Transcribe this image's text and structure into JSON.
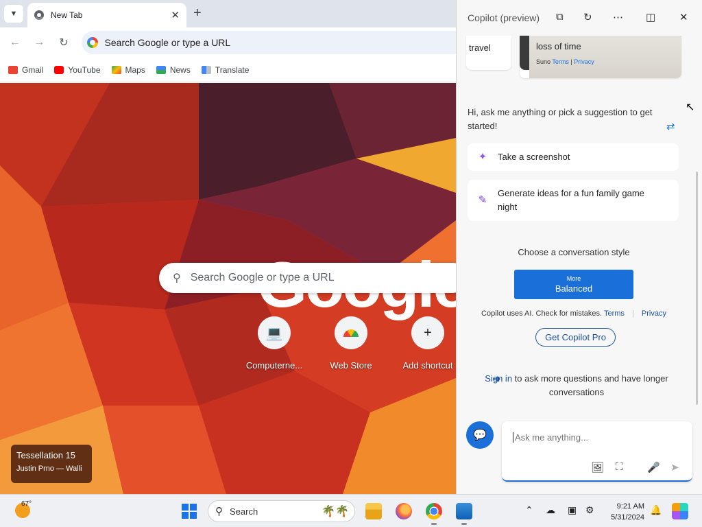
{
  "browser": {
    "tab_title": "New Tab",
    "omnibox_placeholder": "Search Google or type a URL",
    "bookmarks": [
      {
        "label": "Gmail",
        "icon": "gmail-icon",
        "color": "#ea4335"
      },
      {
        "label": "YouTube",
        "icon": "youtube-icon",
        "color": "#ff0000"
      },
      {
        "label": "Maps",
        "icon": "maps-icon",
        "color": "#34a853"
      },
      {
        "label": "News",
        "icon": "news-icon",
        "color": "#4285f4"
      },
      {
        "label": "Translate",
        "icon": "translate-icon",
        "color": "#4285f4"
      }
    ]
  },
  "ntp": {
    "logo": "Google",
    "search_placeholder": "Search Google or type a URL",
    "shortcuts": [
      {
        "label": "Computerne...",
        "icon": "computer-icon"
      },
      {
        "label": "Web Store",
        "icon": "webstore-icon"
      },
      {
        "label": "Add shortcut",
        "icon": "plus-icon"
      }
    ],
    "wallpaper": {
      "title": "Tessellation 15",
      "author": "Justin Prno — Walli"
    }
  },
  "copilot": {
    "title": "Copilot (preview)",
    "card_a_text": "travel",
    "card_b": {
      "title": "loss of time",
      "source": "Suno",
      "terms": "Terms",
      "sep": "|",
      "privacy": "Privacy"
    },
    "greeting": "Hi, ask me anything or pick a suggestion to get started!",
    "suggestions": [
      {
        "label": "Take a screenshot",
        "icon": "sparkle-icon"
      },
      {
        "label": "Generate ideas for a fun family game night",
        "icon": "notepad-icon"
      }
    ],
    "style_label": "Choose a conversation style",
    "style_more": "More",
    "style_selected": "Balanced",
    "disclaimer": "Copilot uses AI. Check for mistakes.",
    "terms": "Terms",
    "privacy": "Privacy",
    "get_pro": "Get Copilot Pro",
    "signin_link": "Sign in",
    "signin_rest": " to ask more questions and have longer conversations",
    "ask_placeholder": "Ask me anything..."
  },
  "taskbar": {
    "weather_temp": "67°",
    "search_label": "Search",
    "time": "9:21 AM",
    "date": "5/31/2024"
  }
}
